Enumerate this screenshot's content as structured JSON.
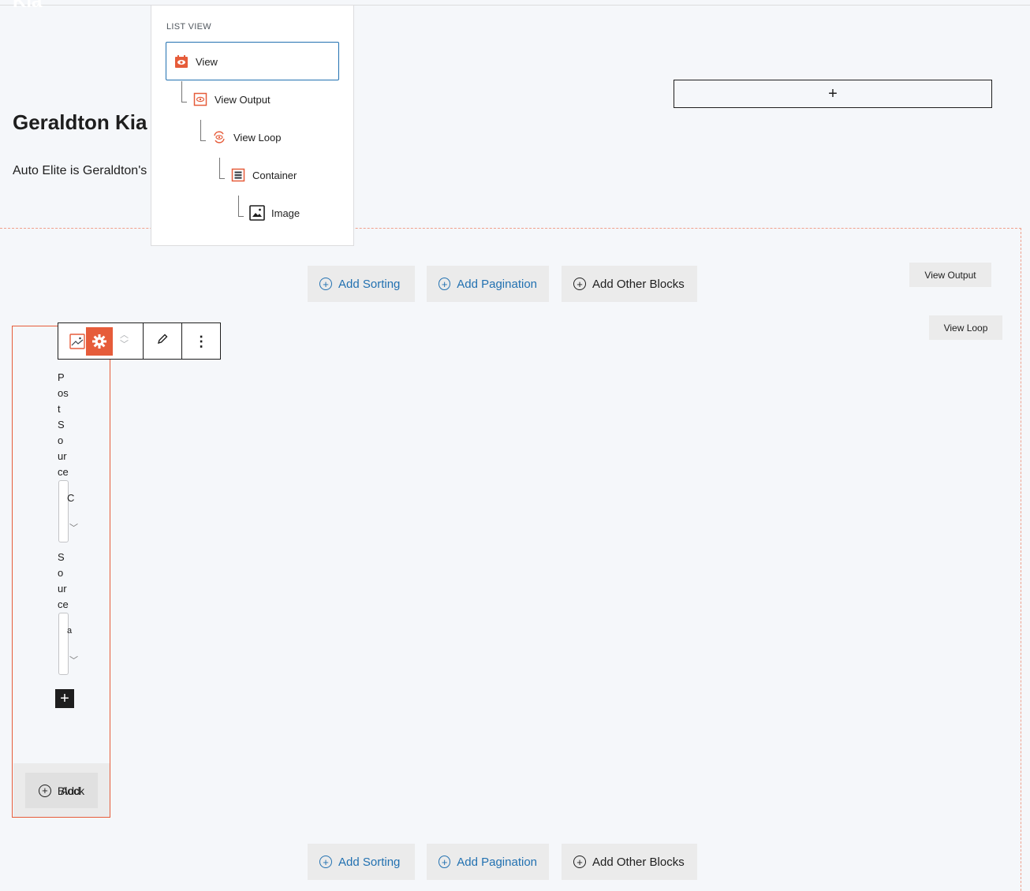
{
  "page": {
    "header_partial": "Kia",
    "title": "Geraldton Kia",
    "description": "Auto Elite is Geraldton's",
    "append_symbol": "+"
  },
  "list_view": {
    "heading": "LIST VIEW",
    "items": [
      {
        "label": "View",
        "icon": "view-icon",
        "selected": true
      },
      {
        "label": "View Output",
        "icon": "view-output-icon"
      },
      {
        "label": "View Loop",
        "icon": "view-loop-icon"
      },
      {
        "label": "Container",
        "icon": "container-icon"
      },
      {
        "label": "Image",
        "icon": "image-icon"
      }
    ]
  },
  "actions_top": {
    "sorting": "Add Sorting",
    "pagination": "Add Pagination",
    "other": "Add Other Blocks"
  },
  "actions_bottom": {
    "sorting": "Add Sorting",
    "pagination": "Add Pagination",
    "other": "Add Other Blocks"
  },
  "labels": {
    "view_output": "View Output",
    "view_loop": "View Loop"
  },
  "block": {
    "post_source_chars": [
      "P",
      "os",
      "t",
      "S",
      "o",
      "ur",
      "ce"
    ],
    "post_source_value": "C",
    "source_chars": [
      "S",
      "o",
      "ur",
      "ce"
    ],
    "source_value": "a",
    "add_block_label": "Block",
    "add_block_overlap": "Add"
  },
  "colors": {
    "accent": "#e65c3a",
    "link": "#2271b1",
    "selection": "#2271b1"
  }
}
